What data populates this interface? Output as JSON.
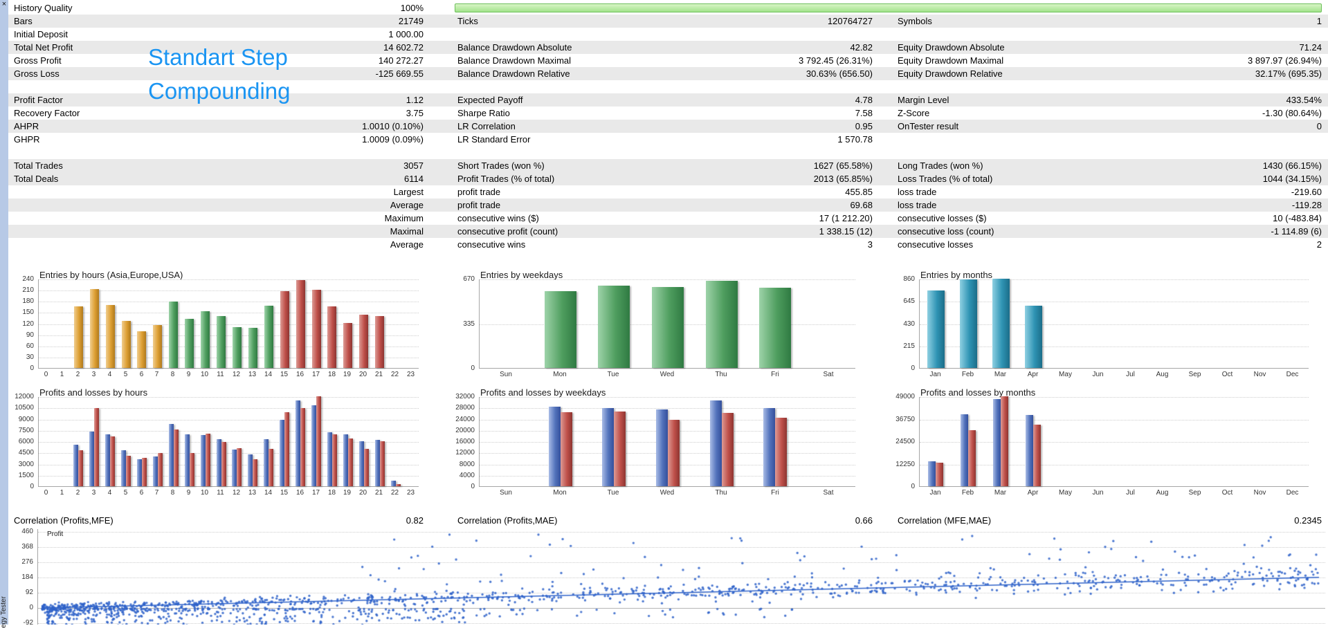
{
  "side": {
    "close_label": "×",
    "tab_label": "egy Tester"
  },
  "watermark": {
    "line1": "Standart Step",
    "line2": "Compounding",
    "color": "#1b95f2"
  },
  "colors": {
    "row_shade": "#e9e9e9",
    "grid": "#cdcdcd",
    "axis": "#a6a6a6"
  },
  "report": {
    "history_quality": {
      "label": "History Quality",
      "value": "100%",
      "bar": {
        "fill_from": "#d8f5c6",
        "fill_to": "#a3e38c",
        "border": "#6cbf5a"
      }
    },
    "rows": [
      {
        "c1l": "Bars",
        "c1v": "21749",
        "c2l": "Ticks",
        "c2v": "120764727",
        "c3l": "Symbols",
        "c3v": "1",
        "shade": true
      },
      {
        "c1l": "Initial Deposit",
        "c1v": "1 000.00",
        "shade": false
      },
      {
        "c1l": "Total Net Profit",
        "c1v": "14 602.72",
        "c2l": "Balance Drawdown Absolute",
        "c2v": "42.82",
        "c3l": "Equity Drawdown Absolute",
        "c3v": "71.24",
        "shade": true
      },
      {
        "c1l": "Gross Profit",
        "c1v": "140 272.27",
        "c2l": "Balance Drawdown Maximal",
        "c2v": "3 792.45 (26.31%)",
        "c3l": "Equity Drawdown Maximal",
        "c3v": "3 897.97 (26.94%)",
        "shade": false
      },
      {
        "c1l": "Gross Loss",
        "c1v": "-125 669.55",
        "c2l": "Balance Drawdown Relative",
        "c2v": "30.63% (656.50)",
        "c3l": "Equity Drawdown Relative",
        "c3v": "32.17% (695.35)",
        "shade": true
      },
      {
        "shade": false
      },
      {
        "c1l": "Profit Factor",
        "c1v": "1.12",
        "c2l": "Expected Payoff",
        "c2v": "4.78",
        "c3l": "Margin Level",
        "c3v": "433.54%",
        "shade": true
      },
      {
        "c1l": "Recovery Factor",
        "c1v": "3.75",
        "c2l": "Sharpe Ratio",
        "c2v": "7.58",
        "c3l": "Z-Score",
        "c3v": "-1.30 (80.64%)",
        "shade": false
      },
      {
        "c1l": "AHPR",
        "c1v": "1.0010 (0.10%)",
        "c2l": "LR Correlation",
        "c2v": "0.95",
        "c3l": "OnTester result",
        "c3v": "0",
        "shade": true
      },
      {
        "c1l": "GHPR",
        "c1v": "1.0009 (0.09%)",
        "c2l": "LR Standard Error",
        "c2v": "1 570.78",
        "shade": false
      },
      {
        "shade": false
      },
      {
        "c1l": "Total Trades",
        "c1v": "3057",
        "c2l": "Short Trades (won %)",
        "c2v": "1627 (65.58%)",
        "c3l": "Long Trades (won %)",
        "c3v": "1430 (66.15%)",
        "shade": true
      },
      {
        "c1l": "Total Deals",
        "c1v": "6114",
        "c2l": "Profit Trades (% of total)",
        "c2v": "2013 (65.85%)",
        "c3l": "Loss Trades (% of total)",
        "c3v": "1044 (34.15%)",
        "shade": true
      },
      {
        "c1v": "Largest",
        "c2l": "profit trade",
        "c2v": "455.85",
        "c3l": "loss trade",
        "c3v": "-219.60",
        "shade": false
      },
      {
        "c1v": "Average",
        "c2l": "profit trade",
        "c2v": "69.68",
        "c3l": "loss trade",
        "c3v": "-119.28",
        "shade": true
      },
      {
        "c1v": "Maximum",
        "c2l": "consecutive wins ($)",
        "c2v": "17 (1 212.20)",
        "c3l": "consecutive losses ($)",
        "c3v": "10 (-483.84)",
        "shade": false
      },
      {
        "c1v": "Maximal",
        "c2l": "consecutive profit (count)",
        "c2v": "1 338.15 (12)",
        "c3l": "consecutive loss (count)",
        "c3v": "-1 114.89 (6)",
        "shade": true
      },
      {
        "c1v": "Average",
        "c2l": "consecutive wins",
        "c2v": "3",
        "c3l": "consecutive losses",
        "c3v": "2",
        "shade": false
      }
    ]
  },
  "correlations": {
    "profits_mfe_label": "Correlation (Profits,MFE)",
    "profits_mfe_value": "0.82",
    "profits_mae_label": "Correlation (Profits,MAE)",
    "profits_mae_value": "0.66",
    "mfe_mae_label": "Correlation (MFE,MAE)",
    "mfe_mae_value": "0.2345"
  },
  "palette": {
    "asia": {
      "light": "#f0cd8e",
      "base": "#dd9f33",
      "dark": "#b07a1d"
    },
    "europe": {
      "light": "#9ed3a9",
      "base": "#4f9e5f",
      "dark": "#2f7a42"
    },
    "usa": {
      "light": "#dd9b95",
      "base": "#bf504a",
      "dark": "#8e3531"
    },
    "months": {
      "light": "#8fd0e2",
      "base": "#2f94b4",
      "dark": "#1b6d89"
    },
    "profit": {
      "light": "#a9bce6",
      "base": "#5272bb",
      "dark": "#34509c"
    },
    "loss": {
      "light": "#dd9b95",
      "base": "#bf504a",
      "dark": "#8e3531"
    },
    "scatter_dot": "#2e62c9"
  },
  "chart_data": [
    {
      "type": "bar",
      "title": "Entries by hours (Asia,Europe,USA)",
      "categories": [
        "0",
        "1",
        "2",
        "3",
        "4",
        "5",
        "6",
        "7",
        "8",
        "9",
        "10",
        "11",
        "12",
        "13",
        "14",
        "15",
        "16",
        "17",
        "18",
        "19",
        "20",
        "21",
        "22",
        "23"
      ],
      "values": [
        0,
        0,
        165,
        212,
        170,
        127,
        98,
        115,
        178,
        133,
        152,
        140,
        110,
        107,
        168,
        207,
        237,
        210,
        165,
        120,
        143,
        140,
        0,
        0
      ],
      "bar_palette": [
        "asia",
        "asia",
        "asia",
        "asia",
        "asia",
        "asia",
        "asia",
        "asia",
        "europe",
        "europe",
        "europe",
        "europe",
        "europe",
        "europe",
        "europe",
        "usa",
        "usa",
        "usa",
        "usa",
        "usa",
        "usa",
        "usa",
        "usa",
        "usa"
      ],
      "ylim": [
        0,
        240
      ],
      "yticks": [
        0,
        30,
        60,
        90,
        120,
        150,
        180,
        210,
        240
      ]
    },
    {
      "type": "bar",
      "title": "Entries by weekdays",
      "categories": [
        "Sun",
        "Mon",
        "Tue",
        "Wed",
        "Thu",
        "Fri",
        "Sat"
      ],
      "values": [
        0,
        575,
        618,
        607,
        652,
        605,
        0
      ],
      "color_key": "europe",
      "ylim": [
        0,
        670
      ],
      "yticks": [
        0,
        335,
        670
      ]
    },
    {
      "type": "bar",
      "title": "Entries by months",
      "categories": [
        "Jan",
        "Feb",
        "Mar",
        "Apr",
        "May",
        "Jun",
        "Jul",
        "Aug",
        "Sep",
        "Oct",
        "Nov",
        "Dec"
      ],
      "values": [
        745,
        855,
        860,
        597,
        0,
        0,
        0,
        0,
        0,
        0,
        0,
        0
      ],
      "color_key": "months",
      "ylim": [
        0,
        860
      ],
      "yticks": [
        0,
        215,
        430,
        645,
        860
      ]
    },
    {
      "type": "bar",
      "title": "Profits and losses by hours",
      "categories": [
        "0",
        "1",
        "2",
        "3",
        "4",
        "5",
        "6",
        "7",
        "8",
        "9",
        "10",
        "11",
        "12",
        "13",
        "14",
        "15",
        "16",
        "17",
        "18",
        "19",
        "20",
        "21",
        "22",
        "23"
      ],
      "series": [
        {
          "name": "profit",
          "color_key": "profit",
          "values": [
            0,
            0,
            5500,
            7300,
            6900,
            4800,
            3600,
            4000,
            8300,
            6900,
            6800,
            6300,
            4900,
            4200,
            6300,
            8900,
            11400,
            10800,
            7200,
            6900,
            6000,
            6200,
            700,
            0
          ]
        },
        {
          "name": "loss",
          "color_key": "loss",
          "values": [
            0,
            0,
            4800,
            10400,
            6600,
            4100,
            3800,
            4400,
            7600,
            4400,
            7000,
            5900,
            5100,
            3600,
            5000,
            9900,
            10400,
            12000,
            6900,
            6400,
            5000,
            6000,
            300,
            0
          ]
        }
      ],
      "ylim": [
        0,
        12000
      ],
      "yticks": [
        0,
        1500,
        3000,
        4500,
        6000,
        7500,
        9000,
        10500,
        12000
      ]
    },
    {
      "type": "bar",
      "title": "Profits and losses by weekdays",
      "categories": [
        "Sun",
        "Mon",
        "Tue",
        "Wed",
        "Thu",
        "Fri",
        "Sat"
      ],
      "series": [
        {
          "name": "profit",
          "color_key": "profit",
          "values": [
            0,
            28300,
            27900,
            27200,
            30600,
            27900,
            0
          ]
        },
        {
          "name": "loss",
          "color_key": "loss",
          "values": [
            0,
            26300,
            26600,
            23700,
            26100,
            24300,
            0
          ]
        }
      ],
      "ylim": [
        0,
        32000
      ],
      "yticks": [
        0,
        4000,
        8000,
        12000,
        16000,
        20000,
        24000,
        28000,
        32000
      ]
    },
    {
      "type": "bar",
      "title": "Profits and losses by months",
      "categories": [
        "Jan",
        "Feb",
        "Mar",
        "Apr",
        "May",
        "Jun",
        "Jul",
        "Aug",
        "Sep",
        "Oct",
        "Nov",
        "Dec"
      ],
      "series": [
        {
          "name": "profit",
          "color_key": "profit",
          "values": [
            13700,
            39200,
            47600,
            39000,
            0,
            0,
            0,
            0,
            0,
            0,
            0,
            0
          ]
        },
        {
          "name": "loss",
          "color_key": "loss",
          "values": [
            13000,
            30400,
            49000,
            33600,
            0,
            0,
            0,
            0,
            0,
            0,
            0,
            0
          ]
        }
      ],
      "ylim": [
        0,
        49000
      ],
      "yticks": [
        0,
        12250,
        24500,
        36750,
        49000
      ]
    },
    {
      "type": "scatter",
      "title": "Profit",
      "yticks": [
        460,
        368,
        276,
        184,
        92,
        0,
        -92
      ],
      "x_axis_visible": false,
      "trend": {
        "slope_y_per_full_width": 185,
        "intercept": 0
      },
      "synthesis": {
        "seed": 1234,
        "band_points": 950,
        "band_noise": 24,
        "loss_points": 430,
        "loss_x_max": 0.33,
        "loss_y_min": -156,
        "outlier_points": 120,
        "outlier_y_max": 445,
        "neg_sprinkle_points": 80
      }
    }
  ]
}
